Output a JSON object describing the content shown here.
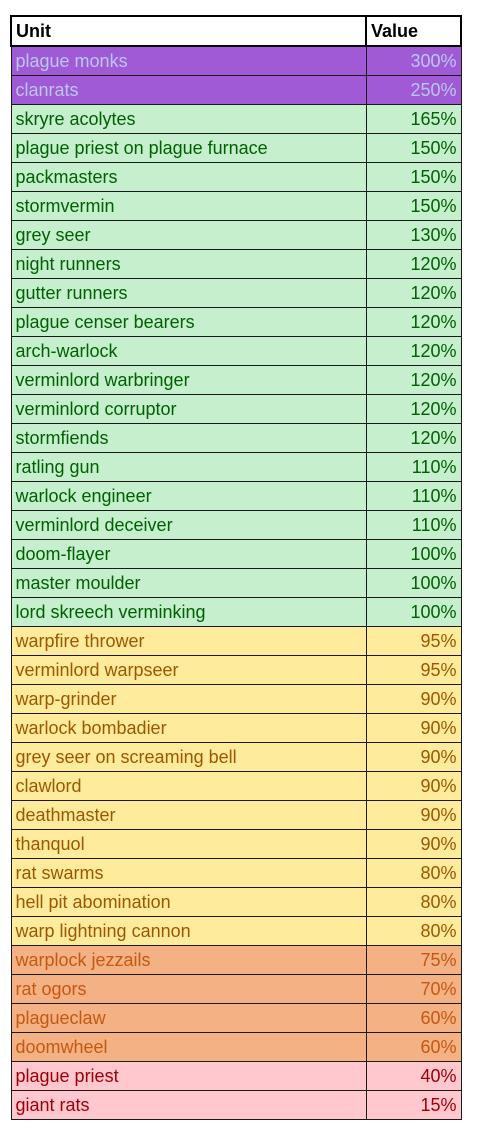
{
  "header": {
    "unit": "Unit",
    "value": "Value"
  },
  "tiers": {
    "purple": {
      "bg": "#a05ad6",
      "fg": "#b9c7f2"
    },
    "green": {
      "bg": "#c6efce",
      "fg": "#006100"
    },
    "yellow": {
      "bg": "#ffeb9c",
      "fg": "#9c5700"
    },
    "orange": {
      "bg": "#f4b183",
      "fg": "#c65911"
    },
    "pink": {
      "bg": "#ffc7ce",
      "fg": "#9c0006"
    }
  },
  "rows": [
    {
      "unit": "plague monks",
      "value": "300%",
      "tier": "purple"
    },
    {
      "unit": "clanrats",
      "value": "250%",
      "tier": "purple"
    },
    {
      "unit": "skryre acolytes",
      "value": "165%",
      "tier": "green"
    },
    {
      "unit": "plague priest on plague furnace",
      "value": "150%",
      "tier": "green"
    },
    {
      "unit": "packmasters",
      "value": "150%",
      "tier": "green"
    },
    {
      "unit": "stormvermin",
      "value": "150%",
      "tier": "green"
    },
    {
      "unit": "grey seer",
      "value": "130%",
      "tier": "green"
    },
    {
      "unit": "night runners",
      "value": "120%",
      "tier": "green"
    },
    {
      "unit": "gutter runners",
      "value": "120%",
      "tier": "green"
    },
    {
      "unit": "plague censer bearers",
      "value": "120%",
      "tier": "green"
    },
    {
      "unit": "arch-warlock",
      "value": "120%",
      "tier": "green"
    },
    {
      "unit": "verminlord warbringer",
      "value": "120%",
      "tier": "green"
    },
    {
      "unit": "verminlord corruptor",
      "value": "120%",
      "tier": "green"
    },
    {
      "unit": "stormfiends",
      "value": "120%",
      "tier": "green"
    },
    {
      "unit": "ratling gun",
      "value": "110%",
      "tier": "green"
    },
    {
      "unit": "warlock engineer",
      "value": "110%",
      "tier": "green"
    },
    {
      "unit": "verminlord deceiver",
      "value": "110%",
      "tier": "green"
    },
    {
      "unit": "doom-flayer",
      "value": "100%",
      "tier": "green"
    },
    {
      "unit": "master moulder",
      "value": "100%",
      "tier": "green"
    },
    {
      "unit": "lord skreech verminking",
      "value": "100%",
      "tier": "green"
    },
    {
      "unit": "warpfire thrower",
      "value": "95%",
      "tier": "yellow"
    },
    {
      "unit": "verminlord warpseer",
      "value": "95%",
      "tier": "yellow"
    },
    {
      "unit": "warp-grinder",
      "value": "90%",
      "tier": "yellow"
    },
    {
      "unit": "warlock bombadier",
      "value": "90%",
      "tier": "yellow"
    },
    {
      "unit": "grey seer on screaming bell",
      "value": "90%",
      "tier": "yellow"
    },
    {
      "unit": "clawlord",
      "value": "90%",
      "tier": "yellow"
    },
    {
      "unit": "deathmaster",
      "value": "90%",
      "tier": "yellow"
    },
    {
      "unit": "thanquol",
      "value": "90%",
      "tier": "yellow"
    },
    {
      "unit": "rat swarms",
      "value": "80%",
      "tier": "yellow"
    },
    {
      "unit": "hell pit abomination",
      "value": "80%",
      "tier": "yellow"
    },
    {
      "unit": "warp lightning cannon",
      "value": "80%",
      "tier": "yellow"
    },
    {
      "unit": "warplock jezzails",
      "value": "75%",
      "tier": "orange"
    },
    {
      "unit": "rat ogors",
      "value": "70%",
      "tier": "orange"
    },
    {
      "unit": "plagueclaw",
      "value": "60%",
      "tier": "orange"
    },
    {
      "unit": "doomwheel",
      "value": "60%",
      "tier": "orange"
    },
    {
      "unit": "plague priest",
      "value": "40%",
      "tier": "pink"
    },
    {
      "unit": "giant rats",
      "value": "15%",
      "tier": "pink"
    }
  ]
}
